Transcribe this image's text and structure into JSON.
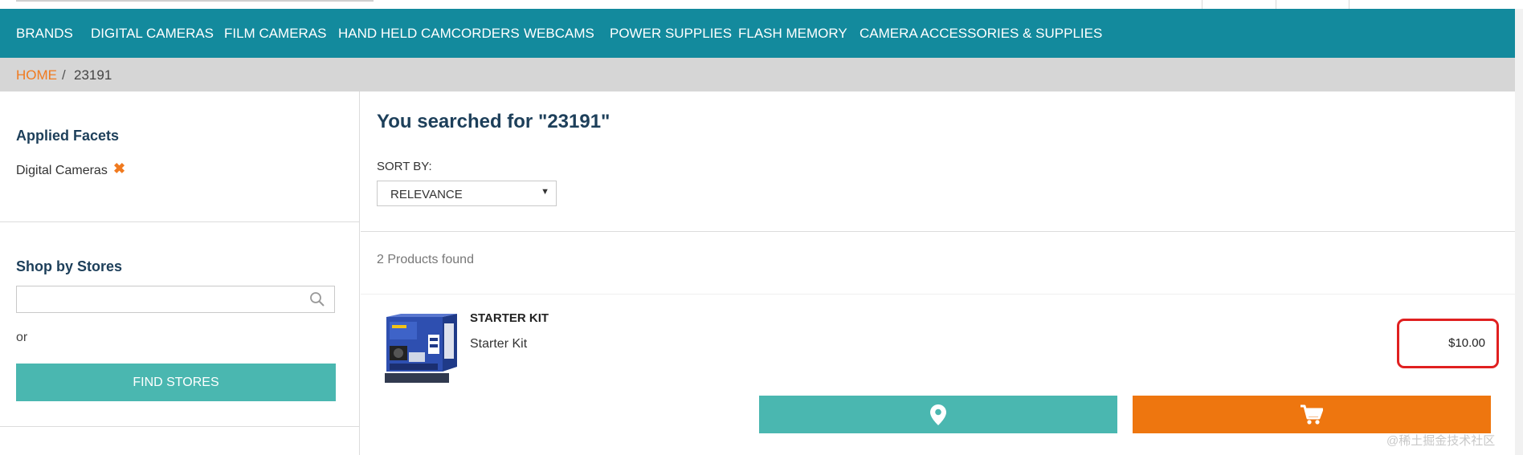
{
  "nav": {
    "items": [
      {
        "label": "BRANDS"
      },
      {
        "label": "DIGITAL CAMERAS"
      },
      {
        "label": "FILM CAMERAS"
      },
      {
        "label": "HAND HELD CAMCORDERS"
      },
      {
        "label": "WEBCAMS"
      },
      {
        "label": "POWER SUPPLIES"
      },
      {
        "label": "FLASH MEMORY"
      },
      {
        "label": "CAMERA ACCESSORIES & SUPPLIES"
      }
    ]
  },
  "breadcrumb": {
    "home": "HOME",
    "separator": "/",
    "current": "23191"
  },
  "sidebar": {
    "facets_title": "Applied Facets",
    "facet_value": "Digital Cameras",
    "facet_remove_glyph": "✖",
    "stores_title": "Shop by Stores",
    "store_search_placeholder": "",
    "or_text": "or",
    "find_stores_label": "FIND STORES"
  },
  "main": {
    "heading": "You searched for \"23191\"",
    "sort_label": "SORT BY:",
    "sort_value": "RELEVANCE",
    "sort_arrow": "▼",
    "results_count": "2 Products found",
    "products": [
      {
        "name": "STARTER KIT",
        "description": "Starter Kit",
        "price": "$10.00",
        "thumbnail_icon": "product-box-image"
      }
    ]
  },
  "watermark": "@稀土掘金技术社区",
  "colors": {
    "nav_bg": "#138a9d",
    "accent_orange": "#f07a1f",
    "cart_orange": "#ee760f",
    "teal_button": "#4ab7b0",
    "heading_navy": "#1d3f5a",
    "price_highlight": "#e02020"
  }
}
